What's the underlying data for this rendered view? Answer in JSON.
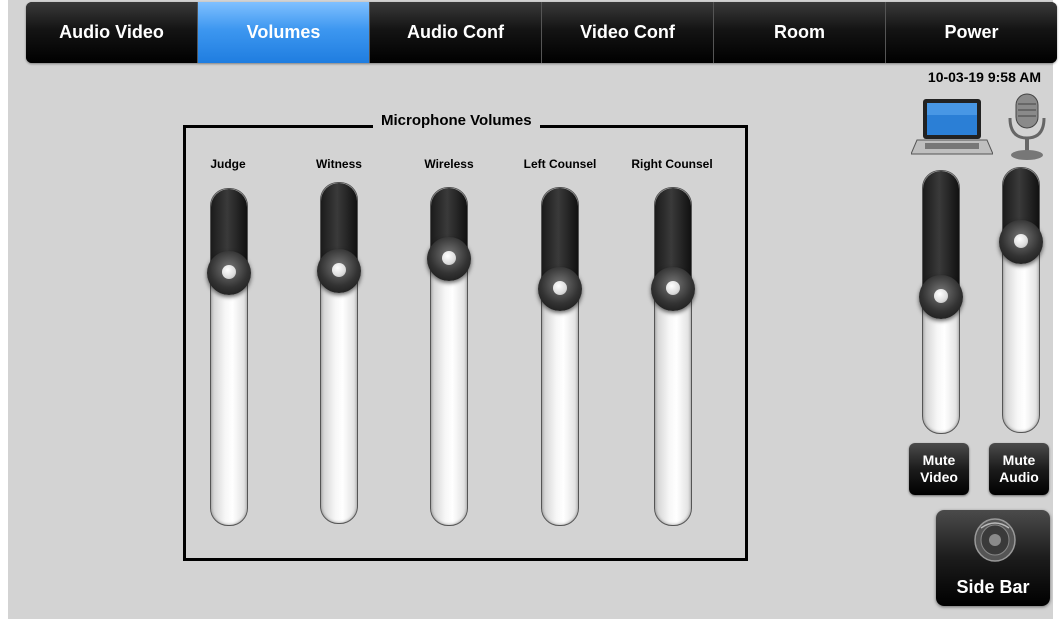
{
  "tabs": [
    {
      "label": "Audio Video",
      "active": false
    },
    {
      "label": "Volumes",
      "active": true
    },
    {
      "label": "Audio Conf",
      "active": false
    },
    {
      "label": "Video Conf",
      "active": false
    },
    {
      "label": "Room",
      "active": false
    },
    {
      "label": "Power",
      "active": false
    }
  ],
  "datetime": "10-03-19 9:58 AM",
  "mic_group": {
    "title": "Microphone Volumes",
    "channels": [
      {
        "label": "Judge",
        "level_pct": 75
      },
      {
        "label": "Witness",
        "level_pct": 74
      },
      {
        "label": "Wireless",
        "level_pct": 79
      },
      {
        "label": "Left Counsel",
        "level_pct": 70
      },
      {
        "label": "Right Counsel",
        "level_pct": 70
      }
    ]
  },
  "outputs": {
    "video": {
      "icon": "laptop-icon",
      "level_pct": 52,
      "mute_line1": "Mute",
      "mute_line2": "Video"
    },
    "audio": {
      "icon": "microphone-icon",
      "level_pct": 72,
      "mute_line1": "Mute",
      "mute_line2": "Audio"
    }
  },
  "side_bar": {
    "label": "Side Bar",
    "icon": "speaker-icon"
  },
  "colors": {
    "active_tab": "#3d97f0",
    "background": "#d3d3d3"
  }
}
